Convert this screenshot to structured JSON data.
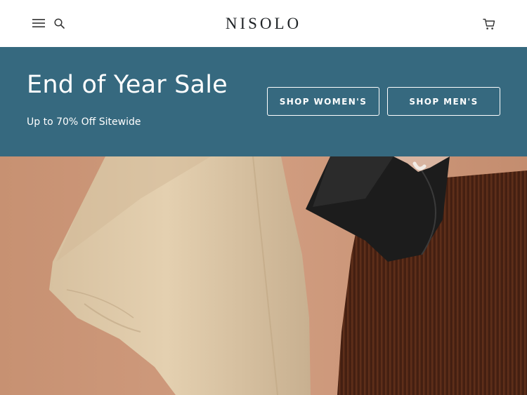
{
  "header": {
    "logo_text": "NISOLO",
    "menu_icon": "hamburger-menu-icon",
    "search_icon": "search-icon",
    "cart_icon": "shopping-cart-icon"
  },
  "banner": {
    "title": "End of Year Sale",
    "subtitle": "Up to 70% Off Sitewide",
    "shop_women_label": "SHOP WOMEN'S",
    "shop_men_label": "SHOP MEN'S",
    "background_color": "#36697f"
  },
  "hero": {
    "background_color": "#c9967a"
  }
}
